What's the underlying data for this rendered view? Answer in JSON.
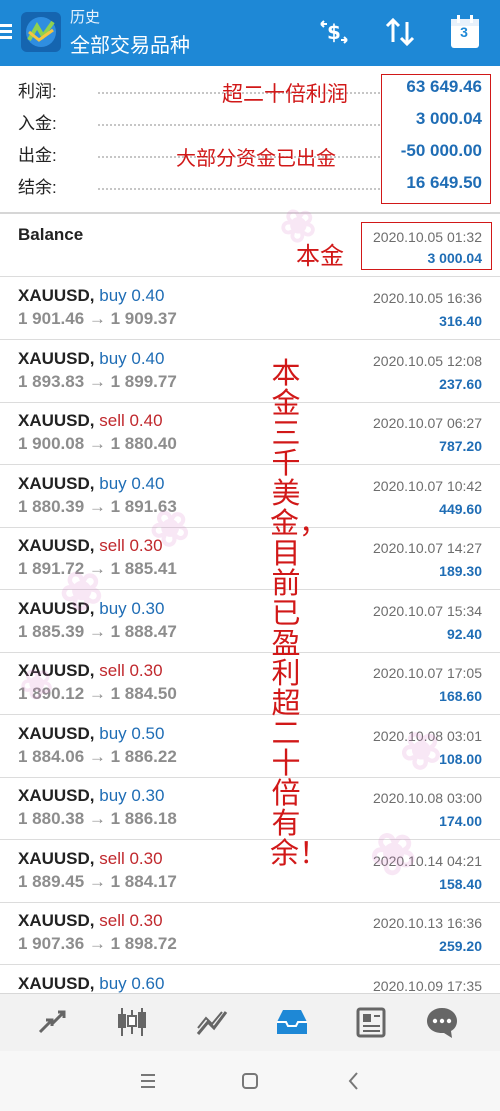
{
  "header": {
    "subtitle": "历史",
    "title": "全部交易品种",
    "calendar_day": "3",
    "icons": [
      "menu-icon",
      "app-logo-icon",
      "currency-icon",
      "sort-icon",
      "calendar-icon"
    ]
  },
  "summary": [
    {
      "label": "利润:",
      "value": "63 649.46"
    },
    {
      "label": "入金:",
      "value": "3 000.04"
    },
    {
      "label": "出金:",
      "value": "-50 000.00"
    },
    {
      "label": "结余:",
      "value": "16 649.50"
    }
  ],
  "balance": {
    "title": "Balance",
    "date": "2020.10.05 01:32",
    "amount": "3 000.04"
  },
  "deals": [
    {
      "symbol": "XAUUSD,",
      "side": "buy 0.40",
      "side_type": "buy",
      "prices": "1 901.46 → 1 909.37",
      "date": "2020.10.05 16:36",
      "profit": "316.40"
    },
    {
      "symbol": "XAUUSD,",
      "side": "buy 0.40",
      "side_type": "buy",
      "prices": "1 893.83 → 1 899.77",
      "date": "2020.10.05 12:08",
      "profit": "237.60"
    },
    {
      "symbol": "XAUUSD,",
      "side": "sell 0.40",
      "side_type": "sell",
      "prices": "1 900.08 → 1 880.40",
      "date": "2020.10.07 06:27",
      "profit": "787.20"
    },
    {
      "symbol": "XAUUSD,",
      "side": "buy 0.40",
      "side_type": "buy",
      "prices": "1 880.39 → 1 891.63",
      "date": "2020.10.07 10:42",
      "profit": "449.60"
    },
    {
      "symbol": "XAUUSD,",
      "side": "sell 0.30",
      "side_type": "sell",
      "prices": "1 891.72 → 1 885.41",
      "date": "2020.10.07 14:27",
      "profit": "189.30"
    },
    {
      "symbol": "XAUUSD,",
      "side": "buy 0.30",
      "side_type": "buy",
      "prices": "1 885.39 → 1 888.47",
      "date": "2020.10.07 15:34",
      "profit": "92.40"
    },
    {
      "symbol": "XAUUSD,",
      "side": "sell 0.30",
      "side_type": "sell",
      "prices": "1 890.12 → 1 884.50",
      "date": "2020.10.07 17:05",
      "profit": "168.60"
    },
    {
      "symbol": "XAUUSD,",
      "side": "buy 0.50",
      "side_type": "buy",
      "prices": "1 884.06 → 1 886.22",
      "date": "2020.10.08 03:01",
      "profit": "108.00"
    },
    {
      "symbol": "XAUUSD,",
      "side": "buy 0.30",
      "side_type": "buy",
      "prices": "1 880.38 → 1 886.18",
      "date": "2020.10.08 03:00",
      "profit": "174.00"
    },
    {
      "symbol": "XAUUSD,",
      "side": "sell 0.30",
      "side_type": "sell",
      "prices": "1 889.45 → 1 884.17",
      "date": "2020.10.14 04:21",
      "profit": "158.40"
    },
    {
      "symbol": "XAUUSD,",
      "side": "sell 0.30",
      "side_type": "sell",
      "prices": "1 907.36 → 1 898.72",
      "date": "2020.10.13 16:36",
      "profit": "259.20"
    },
    {
      "symbol": "XAUUSD,",
      "side": "buy 0.60",
      "side_type": "buy",
      "prices": "",
      "date": "2020.10.09 17:35",
      "profit": ""
    }
  ],
  "annotations": {
    "profit_note": "超二十倍利润",
    "withdraw_note": "大部分资金已出金",
    "principal_note": "本金",
    "vertical_note": "本金三千美金，目前已盈利超二十倍有余！"
  },
  "bottom_nav": [
    "quotes-icon",
    "chart-icon",
    "trade-icon",
    "history-icon",
    "news-icon",
    "chat-icon"
  ],
  "system_nav": [
    "recent-apps-icon",
    "home-icon",
    "back-icon"
  ],
  "colors": {
    "header": "#1e88d6",
    "accent_blue": "#1f6db5",
    "sell_red": "#c0282d",
    "annotation_red": "#d11818"
  }
}
